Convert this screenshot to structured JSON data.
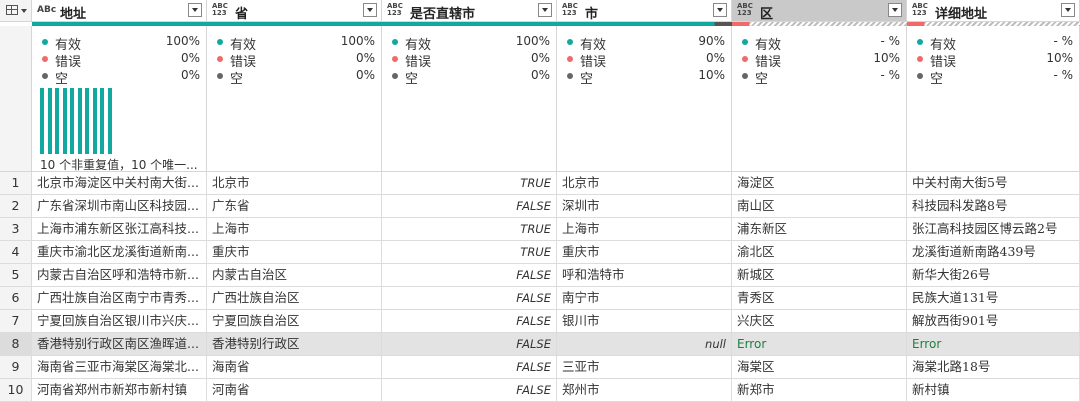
{
  "table_icon": "table-menu-icon",
  "columns": [
    {
      "type_icon": "ABc",
      "type_icon_name": "text-type-icon",
      "name": "地址"
    },
    {
      "type_icon": "ABC 123",
      "type_icon_name": "any-type-icon",
      "name": "省"
    },
    {
      "type_icon": "ABC 123",
      "type_icon_name": "any-type-icon",
      "name": "是否直辖市"
    },
    {
      "type_icon": "ABC 123",
      "type_icon_name": "any-type-icon",
      "name": "市"
    },
    {
      "type_icon": "ABC 123",
      "type_icon_name": "any-type-icon",
      "name": "区"
    },
    {
      "type_icon": "ABC 123",
      "type_icon_name": "any-type-icon",
      "name": "详细地址"
    }
  ],
  "stat_labels": {
    "valid": "有效",
    "error": "错误",
    "empty": "空"
  },
  "colors": {
    "valid": "#11a8a0",
    "error": "#f06a6a",
    "empty": "#666666",
    "quality_mixed_gray": "#c4c4c4"
  },
  "profile": [
    {
      "valid": "100%",
      "error": "0%",
      "empty": "0%",
      "valid_fraction": 1.0,
      "error_fraction": 0.0
    },
    {
      "valid": "100%",
      "error": "0%",
      "empty": "0%",
      "valid_fraction": 1.0,
      "error_fraction": 0.0
    },
    {
      "valid": "100%",
      "error": "0%",
      "empty": "0%",
      "valid_fraction": 1.0,
      "error_fraction": 0.0
    },
    {
      "valid": "90%",
      "error": "0%",
      "empty": "10%",
      "valid_fraction": 0.9,
      "error_fraction": 0.0
    },
    {
      "valid": "- %",
      "error": "10%",
      "empty": "- %",
      "valid_fraction": 0.0,
      "error_fraction": 0.1
    },
    {
      "valid": "- %",
      "error": "10%",
      "empty": "- %",
      "valid_fraction": 0.0,
      "error_fraction": 0.1
    }
  ],
  "distribution_label": "10 个非重复值，10 个唯一...",
  "distribution_bar_count": 10,
  "rows": [
    {
      "n": "1",
      "addr": "北京市海淀区中关村南大街...",
      "prov": "北京市",
      "direct": "TRUE",
      "city": "北京市",
      "dist": "海淀区",
      "detail": "中关村南大街5号"
    },
    {
      "n": "2",
      "addr": "广东省深圳市南山区科技园...",
      "prov": "广东省",
      "direct": "FALSE",
      "city": "深圳市",
      "dist": "南山区",
      "detail": "科技园科发路8号"
    },
    {
      "n": "3",
      "addr": "上海市浦东新区张江高科技...",
      "prov": "上海市",
      "direct": "TRUE",
      "city": "上海市",
      "dist": "浦东新区",
      "detail": "张江高科技园区博云路2号"
    },
    {
      "n": "4",
      "addr": "重庆市渝北区龙溪街道新南...",
      "prov": "重庆市",
      "direct": "TRUE",
      "city": "重庆市",
      "dist": "渝北区",
      "detail": "龙溪街道新南路439号"
    },
    {
      "n": "5",
      "addr": "内蒙古自治区呼和浩特市新...",
      "prov": "内蒙古自治区",
      "direct": "FALSE",
      "city": "呼和浩特市",
      "dist": "新城区",
      "detail": "新华大街26号"
    },
    {
      "n": "6",
      "addr": "广西壮族自治区南宁市青秀...",
      "prov": "广西壮族自治区",
      "direct": "FALSE",
      "city": "南宁市",
      "dist": "青秀区",
      "detail": "民族大道131号"
    },
    {
      "n": "7",
      "addr": "宁夏回族自治区银川市兴庆...",
      "prov": "宁夏回族自治区",
      "direct": "FALSE",
      "city": "银川市",
      "dist": "兴庆区",
      "detail": "解放西街901号"
    },
    {
      "n": "8",
      "addr": "香港特别行政区南区渔晖道...",
      "prov": "香港特别行政区",
      "direct": "FALSE",
      "city": "null",
      "dist": "Error",
      "detail": "Error"
    },
    {
      "n": "9",
      "addr": "海南省三亚市海棠区海棠北...",
      "prov": "海南省",
      "direct": "FALSE",
      "city": "三亚市",
      "dist": "海棠区",
      "detail": "海棠北路18号"
    },
    {
      "n": "10",
      "addr": "河南省郑州市新郑市新村镇",
      "prov": "河南省",
      "direct": "FALSE",
      "city": "郑州市",
      "dist": "新郑市",
      "detail": "新村镇"
    }
  ],
  "selected_row": "8"
}
